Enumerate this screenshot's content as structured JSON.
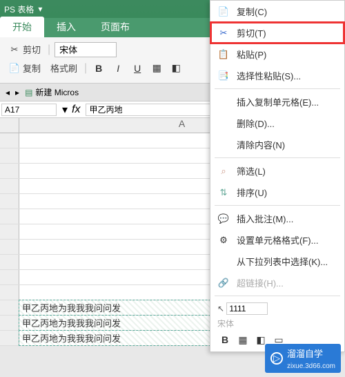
{
  "title_bar": {
    "app": "PS 表格",
    "dropdown_icon": "▾"
  },
  "tabs": {
    "start": "开始",
    "insert": "插入",
    "page_layout": "页面布"
  },
  "ribbon": {
    "cut": "剪切",
    "copy": "复制",
    "format_painter": "格式刷",
    "font_name": "宋体",
    "bold": "B",
    "italic": "I",
    "underline": "U"
  },
  "doc_tabs": {
    "new_doc": "新建 Micros"
  },
  "formula_bar": {
    "name_box": "A17",
    "fx": "fx",
    "content": "甲乙丙地"
  },
  "sheet": {
    "col_label": "A",
    "rows": [
      {
        "n": "",
        "v": ""
      },
      {
        "n": "",
        "v": ""
      },
      {
        "n": "",
        "v": ""
      },
      {
        "n": "",
        "v": ""
      },
      {
        "n": "",
        "v": ""
      },
      {
        "n": "",
        "v": ""
      },
      {
        "n": "",
        "v": ""
      },
      {
        "n": "",
        "v": ""
      },
      {
        "n": "",
        "v": ""
      },
      {
        "n": "",
        "v": ""
      },
      {
        "n": "",
        "v": ""
      },
      {
        "n": "",
        "v": "甲乙丙地为我我我问问发"
      },
      {
        "n": "",
        "v": "甲乙丙地为我我我问问发"
      },
      {
        "n": "",
        "v": "甲乙丙地为我我我问问发"
      }
    ]
  },
  "context_menu": {
    "copy": "复制(C)",
    "cut": "剪切(T)",
    "paste": "粘贴(P)",
    "paste_special": "选择性粘贴(S)...",
    "insert_cells": "插入复制单元格(E)...",
    "delete": "删除(D)...",
    "clear": "清除内容(N)",
    "filter": "筛选(L)",
    "sort": "排序(U)",
    "insert_comment": "插入批注(M)...",
    "format_cells": "设置单元格格式(F)...",
    "dropdown_list": "从下拉列表中选择(K)...",
    "hyperlink": "超链接(H)...",
    "value_box": "1111",
    "font_display": "宋体"
  },
  "watermark": {
    "name": "溜溜自学",
    "sub": "zixue.3d66.com"
  }
}
